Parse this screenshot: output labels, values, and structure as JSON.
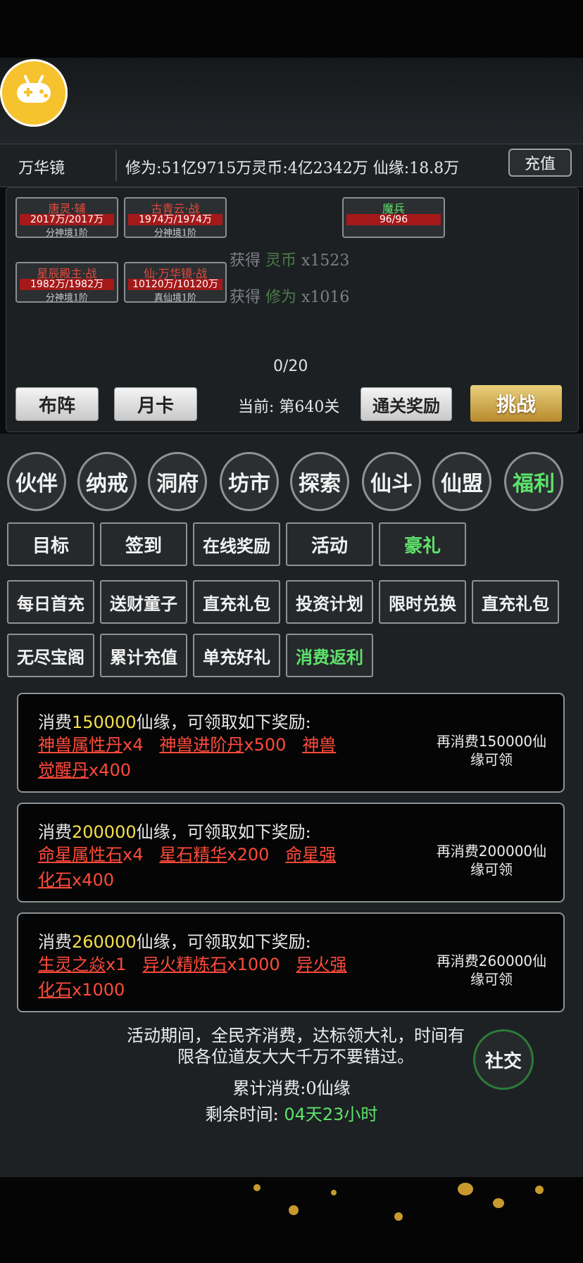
{
  "header": {
    "location": "万华镜",
    "stats_text": "修为:51亿9715万灵币:4亿2342万 仙缘:18.8万",
    "recharge_label": "充值"
  },
  "battle": {
    "units": [
      {
        "name": "唐灵·辅",
        "hp": "2017万/2017万",
        "level": "分神境1阶"
      },
      {
        "name": "古青云·战",
        "hp": "1974万/1974万",
        "level": "分神境1阶"
      },
      {
        "name": "魔兵",
        "hp": "96/96",
        "level": ""
      },
      {
        "name": "星辰殿主·战",
        "hp": "1982万/1982万",
        "level": "分神境1阶"
      },
      {
        "name": "仙·万华镜·战",
        "hp": "10120万/10120万",
        "level": "真仙境1阶"
      }
    ],
    "drops": [
      {
        "prefix": "获得",
        "item": "灵币",
        "count": "x1523"
      },
      {
        "prefix": "获得",
        "item": "修为",
        "count": "x1016"
      }
    ],
    "progress": "0/20",
    "formation_label": "布阵",
    "monthly_card_label": "月卡",
    "stage_text": "当前: 第640关",
    "clear_reward_label": "通关奖励",
    "challenge_label": "挑战"
  },
  "main_nav": [
    "伙伴",
    "纳戒",
    "洞府",
    "坊市",
    "探索",
    "仙斗",
    "仙盟",
    "福利"
  ],
  "sub_tabs": [
    "目标",
    "签到",
    "在线奖励",
    "活动",
    "豪礼"
  ],
  "gift_tabs": [
    "每日首充",
    "送财童子",
    "直充礼包",
    "投资计划",
    "限时兑换",
    "直充礼包",
    "无尽宝阁",
    "累计充值",
    "单充好礼",
    "消费返利"
  ],
  "rewards": [
    {
      "pre": "消费",
      "amount": "150000",
      "post": "仙缘，可领取如下奖励:",
      "items": [
        {
          "name": "神兽属性丹",
          "qty": "x4"
        },
        {
          "name": "神兽进阶丹",
          "qty": "x500"
        },
        {
          "name": "神兽觉醒丹",
          "qty": "x400"
        }
      ],
      "status_amount": "再消费150000仙",
      "status_tail": "缘可领"
    },
    {
      "pre": "消费",
      "amount": "200000",
      "post": "仙缘，可领取如下奖励:",
      "items": [
        {
          "name": "命星属性石",
          "qty": "x4"
        },
        {
          "name": "星石精华",
          "qty": "x200"
        },
        {
          "name": "命星强化石",
          "qty": "x400"
        }
      ],
      "status_amount": "再消费200000仙",
      "status_tail": "缘可领"
    },
    {
      "pre": "消费",
      "amount": "260000",
      "post": "仙缘，可领取如下奖励:",
      "items": [
        {
          "name": "生灵之焱",
          "qty": "x1"
        },
        {
          "name": "异火精炼石",
          "qty": "x1000"
        },
        {
          "name": "异火强化石",
          "qty": "x1000"
        }
      ],
      "status_amount": "再消费260000仙",
      "status_tail": "缘可领"
    }
  ],
  "event": {
    "desc_line1": "活动期间，全民齐消费，达标领大礼，时间有",
    "desc_line2": "限各位道友大大千万不要错过。",
    "total_spent": "累计消费:0仙缘",
    "remaining_label": "剩余时间:",
    "remaining_value": "04天23小时",
    "social_label": "社交"
  },
  "colors": {
    "accent_green": "#5ee36b",
    "item_red": "#ff4a3a",
    "amount_yellow": "#f5e04b",
    "hp_red": "#a5191a",
    "gold_button": "#d4ae55"
  }
}
